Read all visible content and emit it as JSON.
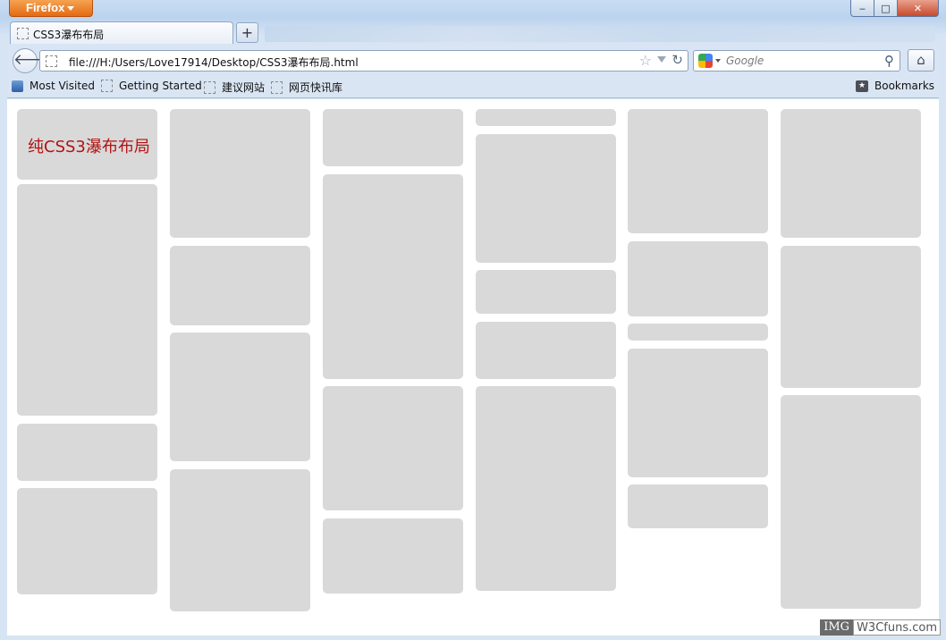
{
  "window": {
    "app_button": "Firefox",
    "controls": {
      "minimize": "‒",
      "maximize": "□",
      "close": "✕"
    }
  },
  "tab": {
    "title": "CSS3瀑布布局",
    "new_tab": "+"
  },
  "navbar": {
    "back": "🡐",
    "url": "file:///H:/Users/Love17914/Desktop/CSS3瀑布布局.html",
    "star": "☆",
    "reload": "↻",
    "search_placeholder": "Google",
    "magnifier": "⚲",
    "home": "⌂"
  },
  "bookmarks": {
    "items": [
      "Most Visited",
      "Getting Started",
      "建议网站",
      "网页快讯库"
    ],
    "bookmarks_menu": "Bookmarks"
  },
  "page": {
    "heading": "纯CSS3瀑布布局"
  },
  "watermark": {
    "left": "IMG",
    "right": "W3Cfuns.com"
  }
}
